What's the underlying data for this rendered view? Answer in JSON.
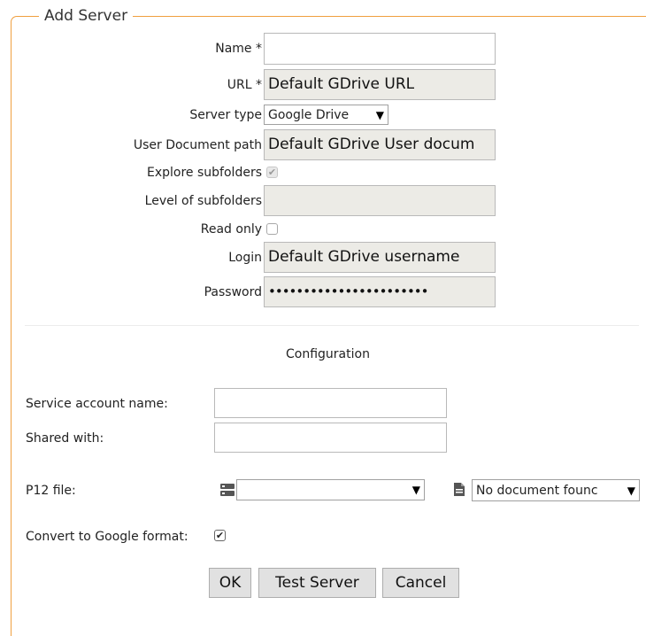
{
  "legend": "Add Server",
  "fields": {
    "name_label": "Name *",
    "name_value": "",
    "url_label": "URL *",
    "url_value": "Default GDrive URL",
    "server_type_label": "Server type",
    "server_type_value": "Google Drive",
    "user_doc_path_label": "User Document path",
    "user_doc_path_value": "Default GDrive User docum",
    "explore_subfolders_label": "Explore subfolders",
    "explore_subfolders_checked": true,
    "level_subfolders_label": "Level of subfolders",
    "level_subfolders_value": "",
    "read_only_label": "Read only",
    "read_only_checked": false,
    "login_label": "Login",
    "login_value": "Default GDrive username",
    "password_label": "Password",
    "password_value": "•••••••••••••••••••••••"
  },
  "configuration": {
    "title": "Configuration",
    "service_account_label": "Service account name:",
    "service_account_value": "",
    "shared_with_label": "Shared with:",
    "shared_with_value": "",
    "p12_label": "P12 file:",
    "p12_select_value": "",
    "document_select_value": "No document founc",
    "convert_label": "Convert to Google format:",
    "convert_checked": true
  },
  "buttons": {
    "ok": "OK",
    "test_server": "Test Server",
    "cancel": "Cancel"
  },
  "icons": {
    "server": "server-icon",
    "document": "document-icon",
    "dropdown": "chevron-down-icon"
  },
  "colors": {
    "fieldset_border": "#f0a040",
    "readonly_input_bg": "#ecebe6"
  }
}
